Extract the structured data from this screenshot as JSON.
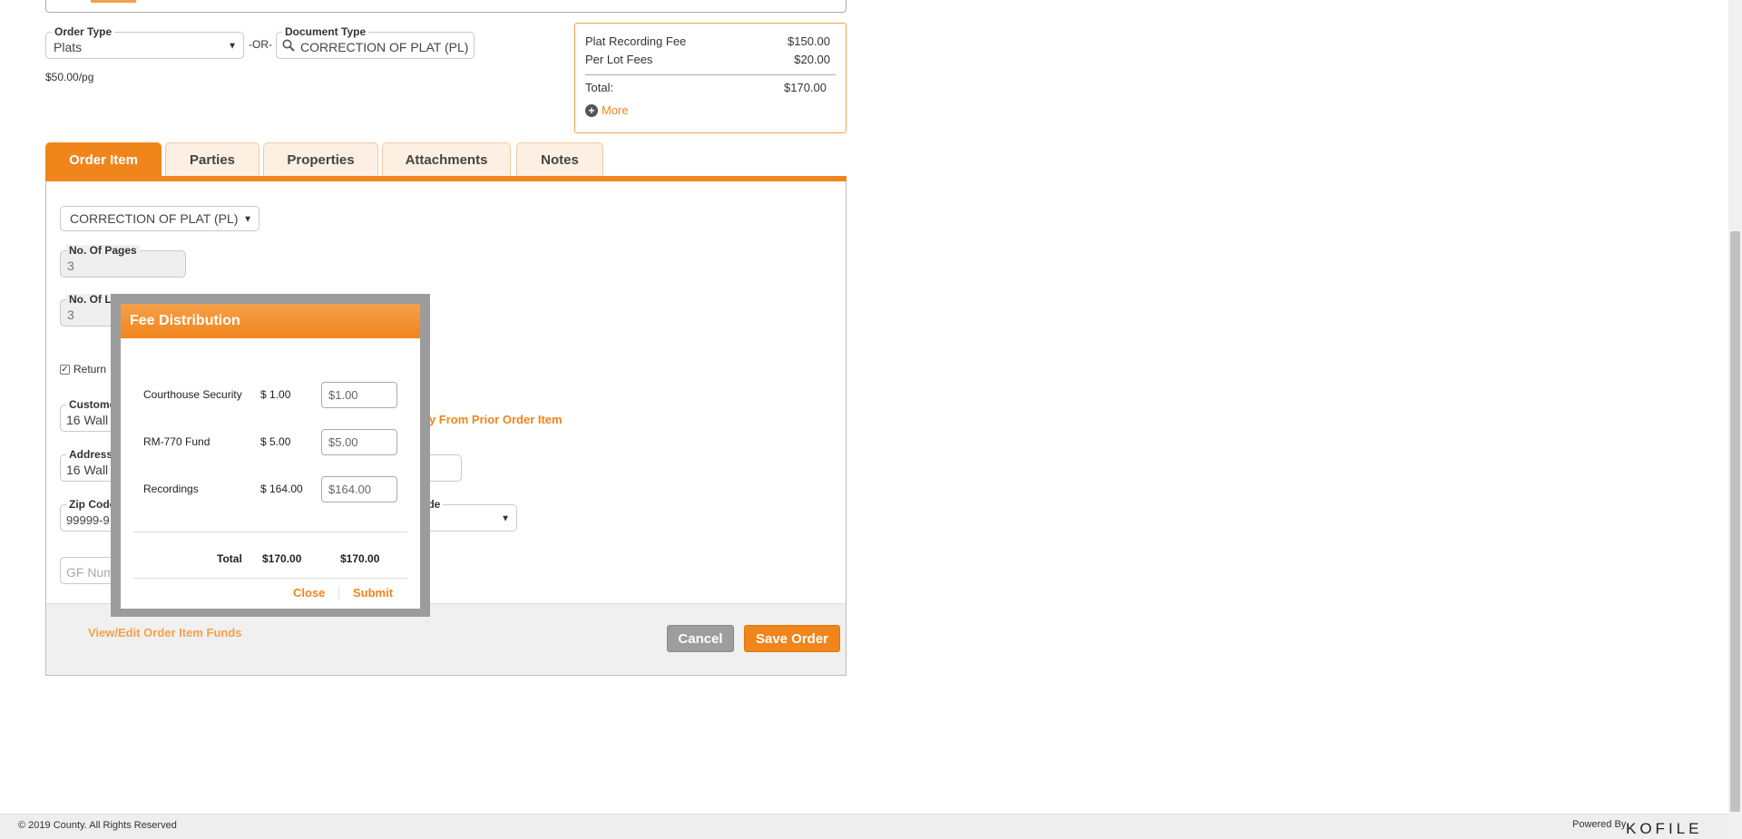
{
  "order_type": {
    "label": "Order Type",
    "value": "Plats",
    "or_label": "-OR-"
  },
  "document_type": {
    "label": "Document Type",
    "value": "CORRECTION OF PLAT (PL)"
  },
  "price_per_page": "$50.00/pg",
  "fees": {
    "items": [
      {
        "label": "Plat Recording Fee",
        "amount": "$150.00"
      },
      {
        "label": "Per Lot Fees",
        "amount": "$20.00"
      }
    ],
    "total_label": "Total:",
    "total_amount": "$170.00",
    "more_label": "More"
  },
  "tabs": [
    {
      "label": "Order Item",
      "active": true
    },
    {
      "label": "Parties"
    },
    {
      "label": "Properties"
    },
    {
      "label": "Attachments"
    },
    {
      "label": "Notes"
    }
  ],
  "order_item": {
    "doc_select": "CORRECTION OF PLAT (PL)",
    "pages_label": "No. Of Pages",
    "pages_value": "3",
    "lots_label": "No. Of Lo",
    "lots_value": "3",
    "return_label": "Return",
    "customer_label": "Custome",
    "customer_value": "16 Wall",
    "copy_link": "py From Prior Order Item",
    "address_label": "Address",
    "address_value": "16 Wall",
    "zip_label": "Zip Code",
    "zip_value": "99999-9",
    "code_label": "ode",
    "gf_placeholder": "GF Num"
  },
  "footer_actions": {
    "funds_link": "View/Edit Order Item Funds",
    "cancel": "Cancel",
    "save": "Save Order"
  },
  "fee_distribution": {
    "title": "Fee Distribution",
    "rows": [
      {
        "label": "Courthouse Security",
        "amount": "$ 1.00",
        "input": "$1.00"
      },
      {
        "label": "RM-770 Fund",
        "amount": "$ 5.00",
        "input": "$5.00"
      },
      {
        "label": "Recordings",
        "amount": "$ 164.00",
        "input": "$164.00"
      }
    ],
    "total_label": "Total",
    "total_amount": "$170.00",
    "total_input": "$170.00",
    "close": "Close",
    "submit": "Submit"
  },
  "page_footer": {
    "copyright": "© 2019 County. All Rights Reserved",
    "powered_by": "Powered By",
    "brand": "KOFILE"
  },
  "colors": {
    "accent": "#f0851c",
    "cancel": "#9d9d9d"
  }
}
